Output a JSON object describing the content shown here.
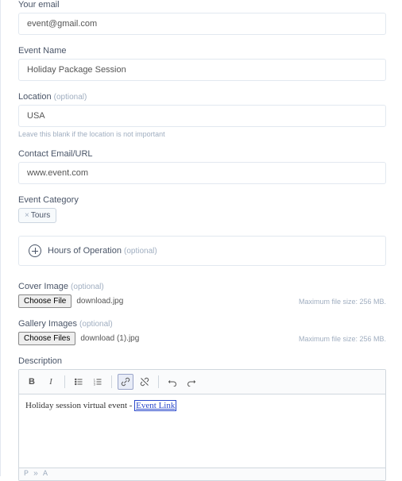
{
  "email": {
    "label": "Your email",
    "value": "event@gmail.com"
  },
  "eventName": {
    "label": "Event Name",
    "value": "Holiday Package Session"
  },
  "location": {
    "label": "Location",
    "opt": "(optional)",
    "value": "USA",
    "help": "Leave this blank if the location is not important"
  },
  "contact": {
    "label": "Contact Email/URL",
    "value": "www.event.com"
  },
  "category": {
    "label": "Event Category",
    "tag": "Tours"
  },
  "hours": {
    "label": "Hours of Operation",
    "opt": "(optional)"
  },
  "cover": {
    "label": "Cover Image",
    "opt": "(optional)",
    "btn": "Choose File",
    "file": "download.jpg",
    "max": "Maximum file size: 256 MB."
  },
  "gallery": {
    "label": "Gallery Images",
    "opt": "(optional)",
    "btn": "Choose Files",
    "file": "download (1).jpg",
    "max": "Maximum file size: 256 MB."
  },
  "description": {
    "label": "Description",
    "content_plain": "Holiday session virtual event - ",
    "content_link": "Event Link",
    "status": "P » A"
  },
  "tb": {
    "bold": "B",
    "italic": "I"
  }
}
